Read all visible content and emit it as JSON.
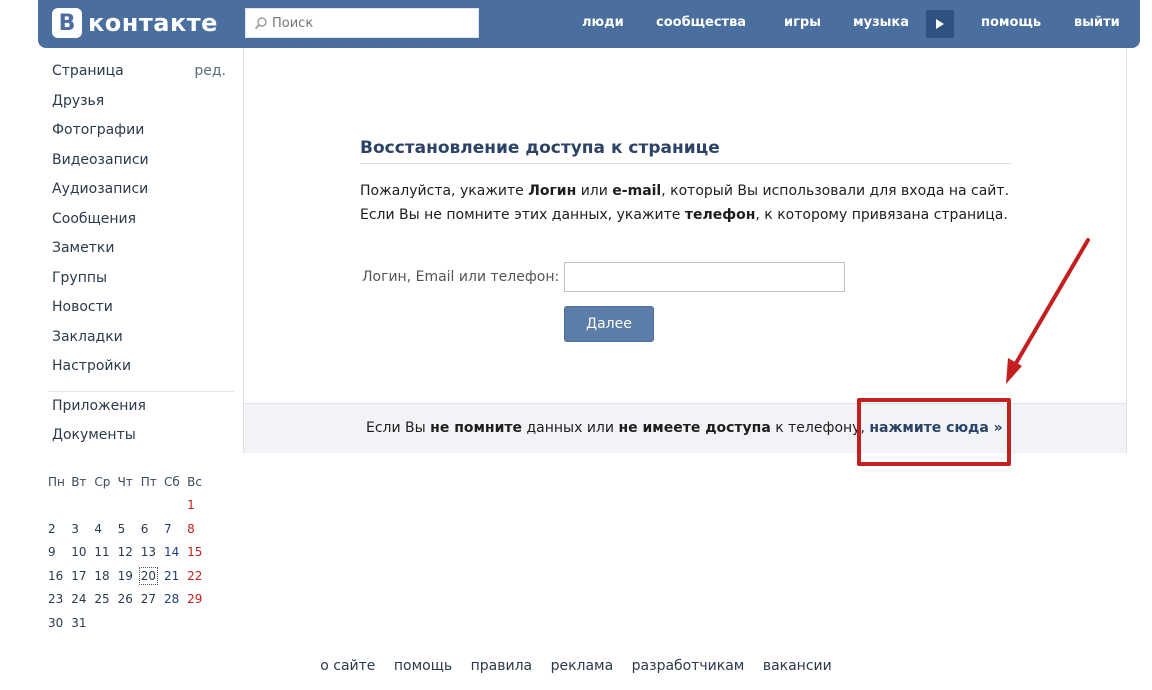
{
  "header": {
    "logo_letter": "B",
    "logo_text": "контакте",
    "search_placeholder": "Поиск",
    "nav": [
      "люди",
      "сообщества",
      "игры",
      "музыка",
      "помощь",
      "выйти"
    ]
  },
  "sidebar": {
    "edit_label": "ред.",
    "items": [
      "Страница",
      "Друзья",
      "Фотографии",
      "Видеозаписи",
      "Аудиозаписи",
      "Сообщения",
      "Заметки",
      "Группы",
      "Новости",
      "Закладки",
      "Настройки"
    ],
    "extra_items": [
      "Приложения",
      "Документы"
    ]
  },
  "calendar": {
    "weekdays": [
      "Пн",
      "Вт",
      "Ср",
      "Чт",
      "Пт",
      "Сб",
      "Вс"
    ],
    "weeks": [
      [
        "",
        "",
        "",
        "",
        "",
        "",
        "1"
      ],
      [
        "2",
        "3",
        "4",
        "5",
        "6",
        "7",
        "8"
      ],
      [
        "9",
        "10",
        "11",
        "12",
        "13",
        "14",
        "15"
      ],
      [
        "16",
        "17",
        "18",
        "19",
        "20",
        "21",
        "22"
      ],
      [
        "23",
        "24",
        "25",
        "26",
        "27",
        "28",
        "29"
      ],
      [
        "30",
        "31",
        "",
        "",
        "",
        "",
        ""
      ]
    ],
    "today": "20"
  },
  "main": {
    "title": "Восстановление доступа к странице",
    "line1": {
      "p1": "Пожалуйста, укажите ",
      "b1": "Логин",
      "p2": " или ",
      "b2": "e-mail",
      "p3": ", который Вы использовали для входа на сайт."
    },
    "line2": {
      "p1": "Если Вы не помните этих данных, укажите ",
      "b1": "телефон",
      "p2": ", к которому привязана страница."
    },
    "field_label": "Логин, Email или телефон:",
    "field_value": "",
    "button_label": "Далее",
    "footer": {
      "p1": "Если Вы ",
      "b1": "не помните",
      "p2": " данных или ",
      "b2": "не имеете доступа",
      "p3": " к телефону, ",
      "link": "нажмите сюда »"
    }
  },
  "page_footer": [
    "о сайте",
    "помощь",
    "правила",
    "реклама",
    "разработчикам",
    "вакансии"
  ],
  "colors": {
    "header": "#4a6f9e",
    "annotation": "#c41f1f",
    "button": "#5b7ea8"
  }
}
